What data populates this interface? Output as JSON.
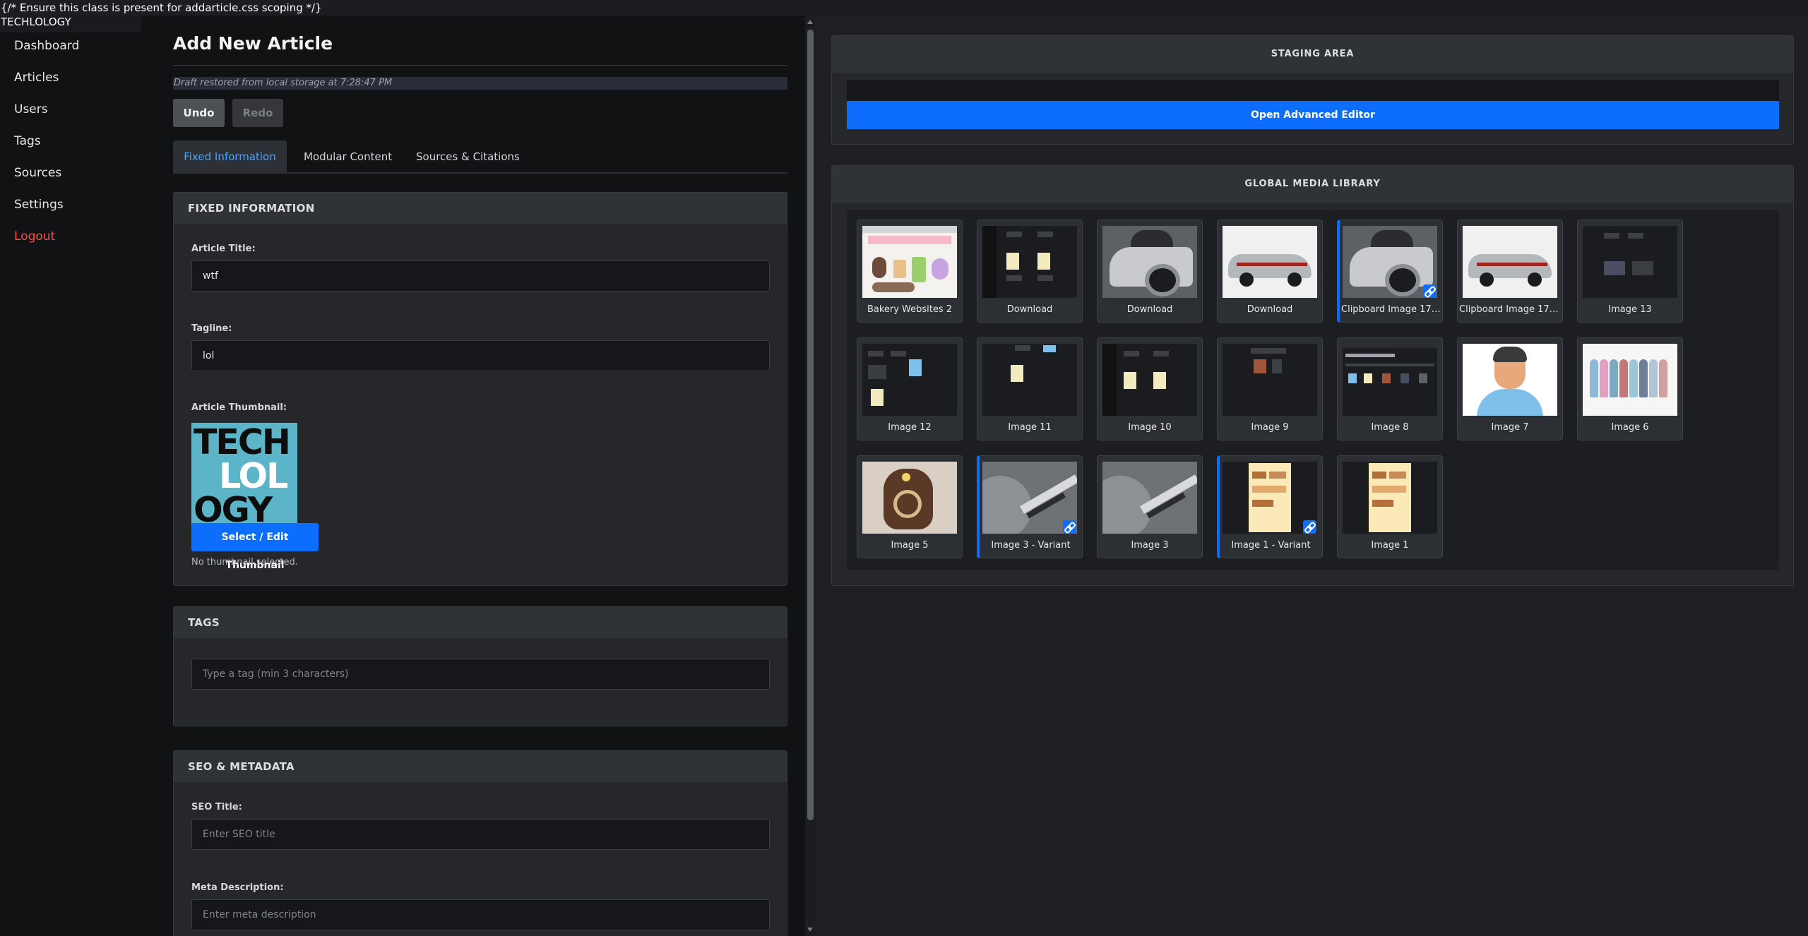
{
  "page": {
    "top_comment": "{/* Ensure this class is present for addarticle.css scoping */}",
    "brand": "TECHLOLOGY"
  },
  "sidebar": {
    "items": [
      {
        "label": "Dashboard"
      },
      {
        "label": "Articles"
      },
      {
        "label": "Users"
      },
      {
        "label": "Tags"
      },
      {
        "label": "Sources"
      },
      {
        "label": "Settings"
      },
      {
        "label": "Logout"
      }
    ]
  },
  "editor": {
    "title": "Add New Article",
    "draft_note": "Draft restored from local storage at 7:28:47 PM",
    "undo_label": "Undo",
    "redo_label": "Redo",
    "tabs": [
      {
        "label": "Fixed Information",
        "active": true
      },
      {
        "label": "Modular Content",
        "active": false
      },
      {
        "label": "Sources & Citations",
        "active": false
      }
    ],
    "fixed_info": {
      "header": "FIXED INFORMATION",
      "title_label": "Article Title:",
      "title_value": "wtf",
      "tagline_label": "Tagline:",
      "tagline_value": "lol",
      "thumbnail_label": "Article Thumbnail:",
      "thumbnail_logo_lines": [
        "TECH",
        "LOL",
        "OGY"
      ],
      "thumbnail_button": "Select / Edit Thumbnail",
      "thumbnail_status": "No thumbnail selected."
    },
    "tags": {
      "header": "TAGS",
      "placeholder": "Type a tag (min 3 characters)"
    },
    "seo": {
      "header": "SEO & METADATA",
      "seo_title_label": "SEO Title:",
      "seo_title_placeholder": "Enter SEO title",
      "meta_desc_label": "Meta Description:",
      "meta_desc_placeholder": "Enter meta description"
    }
  },
  "staging": {
    "header": "STAGING AREA",
    "open_editor_label": "Open Advanced Editor"
  },
  "media_library": {
    "header": "GLOBAL MEDIA LIBRARY",
    "items": [
      {
        "label": "Bakery Websites 2",
        "variant": false
      },
      {
        "label": "Download",
        "variant": false
      },
      {
        "label": "Download",
        "variant": false
      },
      {
        "label": "Download",
        "variant": false
      },
      {
        "label": "Clipboard Image 174...",
        "variant": true
      },
      {
        "label": "Clipboard Image 174...",
        "variant": false
      },
      {
        "label": "Image 13",
        "variant": false
      },
      {
        "label": "Image 12",
        "variant": false
      },
      {
        "label": "Image 11",
        "variant": false
      },
      {
        "label": "Image 10",
        "variant": false
      },
      {
        "label": "Image 9",
        "variant": false
      },
      {
        "label": "Image 8",
        "variant": false
      },
      {
        "label": "Image 7",
        "variant": false
      },
      {
        "label": "Image 6",
        "variant": false
      },
      {
        "label": "Image 5",
        "variant": false
      },
      {
        "label": "Image 3 - Variant",
        "variant": true
      },
      {
        "label": "Image 3",
        "variant": false
      },
      {
        "label": "Image 1 - Variant",
        "variant": true
      },
      {
        "label": "Image 1",
        "variant": false
      }
    ]
  },
  "colors": {
    "accent": "#0d6efd",
    "tab_active": "#4ca3ff",
    "logout": "#ff4b4b",
    "background": "#1a1b1e"
  }
}
